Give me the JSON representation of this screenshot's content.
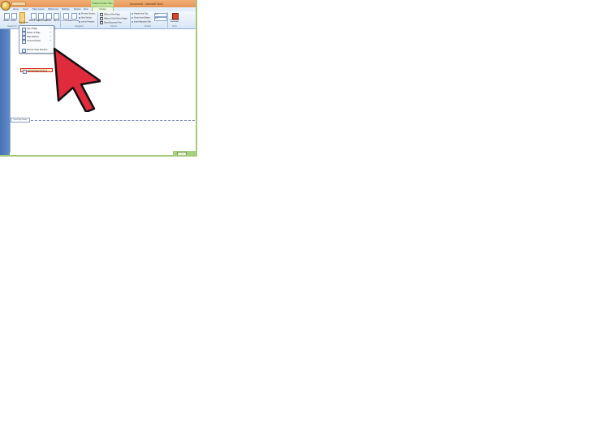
{
  "window": {
    "title": "Document1 - Microsoft Word",
    "context_tab_group": "Header & Footer Tools"
  },
  "tabs": [
    "Home",
    "Insert",
    "Page Layout",
    "References",
    "Mailings",
    "Review",
    "View"
  ],
  "active_tab": "Design",
  "ribbon": {
    "groups": {
      "header_footer": "Header & F...",
      "navigation": "Navigation",
      "options": "Options",
      "position": "Position",
      "close": "Close"
    },
    "buttons": {
      "header": "Header",
      "footer": "Footer",
      "page_number": "Page Number",
      "date_time": "Date & Time",
      "quick_parts": "Quick Parts",
      "picture": "Picture",
      "clip_art": "Clip Art",
      "go_to_header": "Go to Header",
      "go_to_footer": "Go to Footer",
      "previous_section": "Previous Section",
      "next_section": "Next Section",
      "link_to_previous": "Link to Previous",
      "different_first_page": "Different First Page",
      "different_odd_even": "Different Odd & Even Pages",
      "show_document_text": "Show Document Text",
      "header_from_top": "Header from Top:",
      "footer_from_bottom": "Footer from Bottom:",
      "insert_alignment_tab": "Insert Alignment Tab",
      "header_from_top_value": "0.5\"",
      "footer_from_bottom_value": "0.5\"",
      "close_header_footer": "Close Header and Footer"
    }
  },
  "menu": {
    "items": [
      {
        "label": "Top of Page"
      },
      {
        "label": "Bottom of Page"
      },
      {
        "label": "Page Margins"
      },
      {
        "label": "Current Position"
      },
      {
        "label": "Format Page Numbers..."
      },
      {
        "label": "Remove Page Numbers"
      }
    ]
  },
  "document": {
    "footer_tag": "First Page Footer"
  },
  "colors": {
    "ribbon_bg": "#dfeaf7",
    "title_bar": "#eba267",
    "context_tab": "#bfe39a",
    "highlight_border": "#d72a2a",
    "arrow_fill": "#e02b3d"
  }
}
